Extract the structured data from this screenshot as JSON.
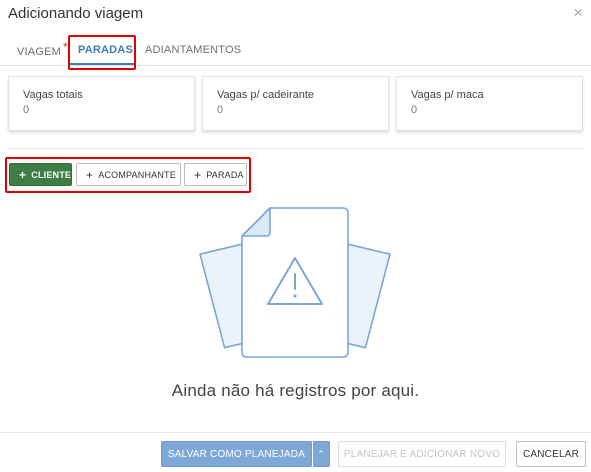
{
  "dialog": {
    "title": "Adicionando viagem",
    "close_glyph": "×"
  },
  "tabs": [
    {
      "label": "VIAGEM",
      "required_mark": "*"
    },
    {
      "label": "PARADAS",
      "active": true
    },
    {
      "label": "ADIANTAMENTOS"
    }
  ],
  "cards": [
    {
      "label": "Vagas totais",
      "value": "0"
    },
    {
      "label": "Vagas p/ cadeirante",
      "value": "0"
    },
    {
      "label": "Vagas p/ maca",
      "value": "0"
    }
  ],
  "actions": {
    "plus_glyph": "+",
    "cliente": "CLIENTE",
    "acompanhante": "ACOMPANHANTE",
    "parada": "PARADA"
  },
  "empty_state": {
    "message": "Ainda não há registros por aqui.",
    "icon": "document-warning-icon"
  },
  "footer": {
    "save_planned": "SALVAR COMO PLANEJADA",
    "caret_glyph": "⌃",
    "plan_add_new": "PLANEJAR E ADICIONAR NOVO",
    "cancel": "CANCELAR"
  },
  "colors": {
    "accent": "#3d7bb8",
    "primary_button": "#3f7d45",
    "save_button": "#7ea8d6",
    "highlight": "#e00000",
    "illustration_stroke": "#7aa7d9",
    "illustration_fill": "#eaf2fb"
  }
}
